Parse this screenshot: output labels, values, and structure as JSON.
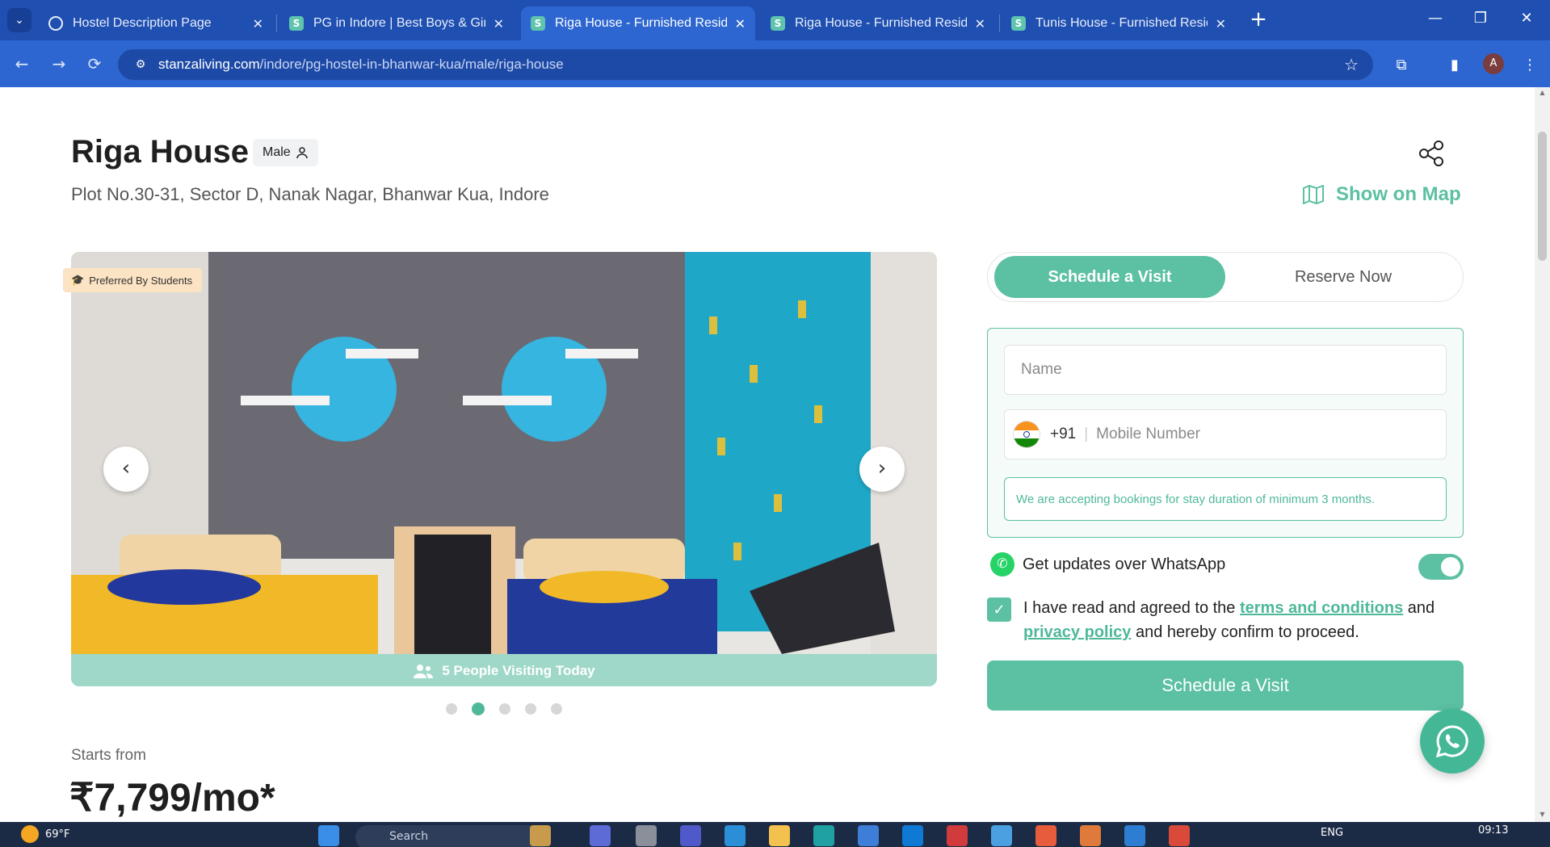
{
  "browser": {
    "tabs": [
      {
        "title": "Hostel Description Page",
        "active": false
      },
      {
        "title": "PG in Indore | Best Boys & Girls",
        "active": false
      },
      {
        "title": "Riga House - Furnished Residen",
        "active": true
      },
      {
        "title": "Riga House - Furnished Residen",
        "active": false
      },
      {
        "title": "Tunis House - Furnished Reside",
        "active": false
      }
    ],
    "url_domain": "stanzaliving.com",
    "url_path": "/indore/pg-hostel-in-bhanwar-kua/male/riga-house",
    "profile_initial": "A"
  },
  "property": {
    "name": "Riga House",
    "gender": "Male",
    "address": "Plot No.30-31, Sector D, Nanak Nagar, Bhanwar Kua, Indore",
    "show_on_map": "Show on Map"
  },
  "gallery": {
    "badge": "Preferred By Students",
    "visiting_text": "5 People Visiting Today",
    "slide_count": 5,
    "active_slide": 2
  },
  "pricing": {
    "label": "Starts from",
    "price": "₹7,799/mo*"
  },
  "booking": {
    "tabs": {
      "schedule": "Schedule a Visit",
      "reserve": "Reserve Now"
    },
    "name_placeholder": "Name",
    "country_code": "+91",
    "mobile_placeholder": "Mobile Number",
    "notice": "We are accepting bookings for stay duration of minimum 3 months.",
    "whatsapp_label": "Get updates over WhatsApp",
    "whatsapp_enabled": true,
    "terms_pre": "I have read and agreed to the",
    "terms_link": "terms and conditions",
    "terms_and": "and",
    "privacy_link": "privacy policy",
    "terms_post": "and hereby confirm to proceed.",
    "submit": "Schedule a Visit"
  },
  "taskbar": {
    "temperature": "69°F",
    "search_placeholder": "Search",
    "language": "ENG",
    "time": "09:13"
  },
  "colors": {
    "accent": "#5cc0a3",
    "browser_blue": "#2d66d0"
  }
}
